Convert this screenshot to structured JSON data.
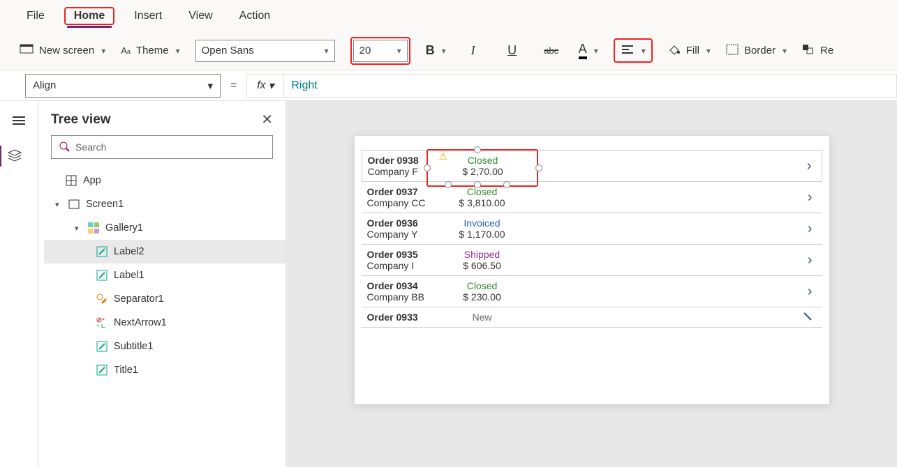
{
  "menu": {
    "items": [
      "File",
      "Home",
      "Insert",
      "View",
      "Action"
    ],
    "active": "Home"
  },
  "ribbon": {
    "newScreen": "New screen",
    "theme": "Theme",
    "font": "Open Sans",
    "fontSize": "20",
    "fill": "Fill",
    "border": "Border",
    "re": "Re"
  },
  "formula": {
    "property": "Align",
    "value": "Right"
  },
  "treePanel": {
    "title": "Tree view",
    "searchPlaceholder": "Search",
    "nodes": {
      "app": "App",
      "screen": "Screen1",
      "gallery": "Gallery1",
      "label2": "Label2",
      "label1": "Label1",
      "separator": "Separator1",
      "nextArrow": "NextArrow1",
      "subtitle": "Subtitle1",
      "title": "Title1"
    }
  },
  "gallery": [
    {
      "order": "Order 0938",
      "company": "Company F",
      "status": "Closed",
      "statusCls": "closed",
      "price": "$ 2,70.00"
    },
    {
      "order": "Order 0937",
      "company": "Company CC",
      "status": "Closed",
      "statusCls": "closed",
      "price": "$ 3,810.00"
    },
    {
      "order": "Order 0936",
      "company": "Company Y",
      "status": "Invoiced",
      "statusCls": "invoiced",
      "price": "$ 1,170.00"
    },
    {
      "order": "Order 0935",
      "company": "Company I",
      "status": "Shipped",
      "statusCls": "shipped",
      "price": "$ 606.50"
    },
    {
      "order": "Order 0934",
      "company": "Company BB",
      "status": "Closed",
      "statusCls": "closed",
      "price": "$ 230.00"
    },
    {
      "order": "Order 0933",
      "company": "",
      "status": "New",
      "statusCls": "new",
      "price": ""
    }
  ]
}
